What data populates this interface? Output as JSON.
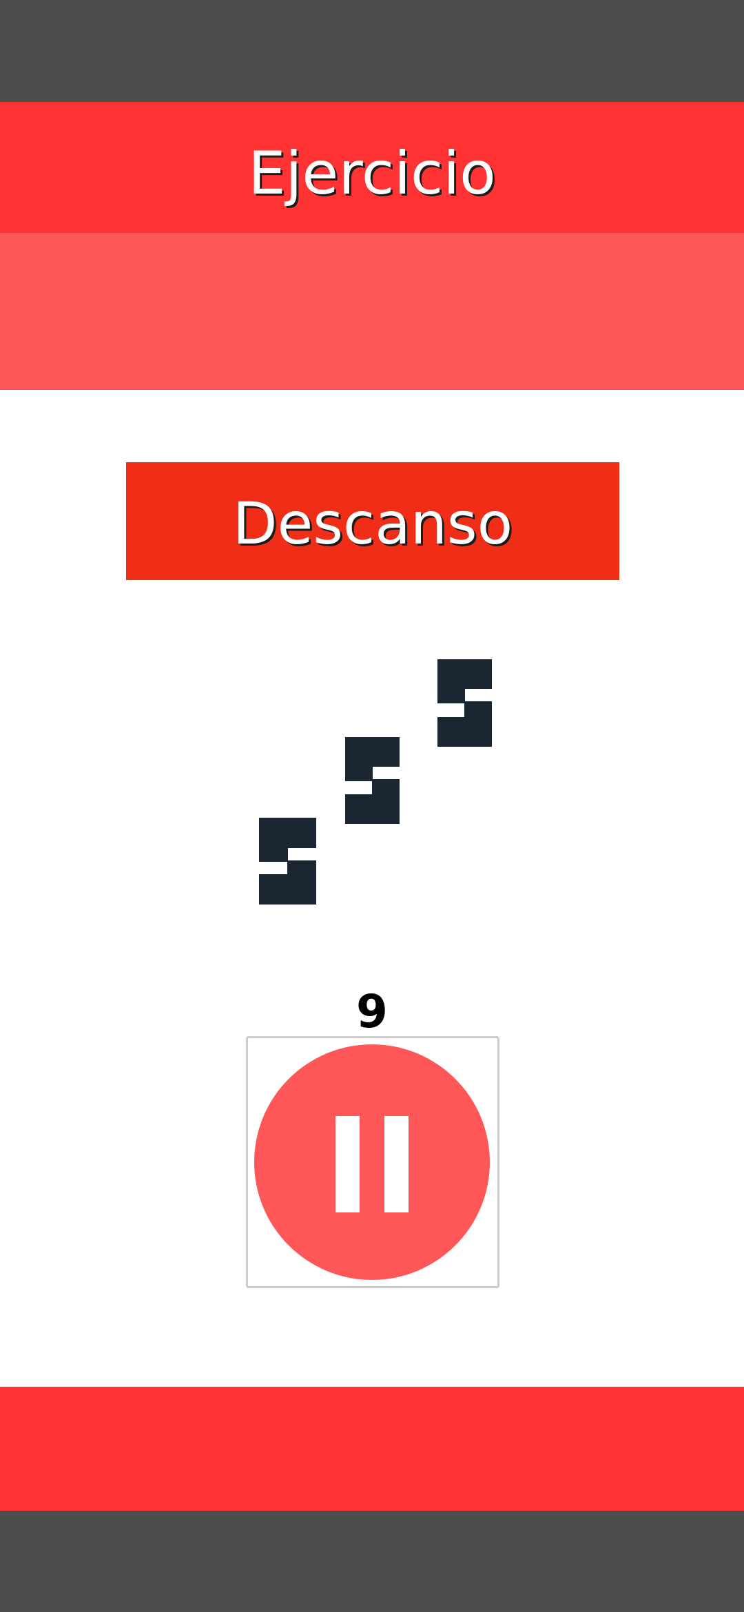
{
  "app_bar": {
    "title": "Ejercicio"
  },
  "mode": {
    "label": "Descanso"
  },
  "rest_illustration": {
    "icon": "sleeping-zzz-icon"
  },
  "timer": {
    "value": "9"
  },
  "pause_control": {
    "icon": "pause-icon"
  },
  "colors": {
    "status_bar": "#4d4d4d",
    "primary": "#ff3333",
    "primary_light": "#ff5757",
    "banner": "#f02d16",
    "icon_dark": "#1a2632"
  }
}
